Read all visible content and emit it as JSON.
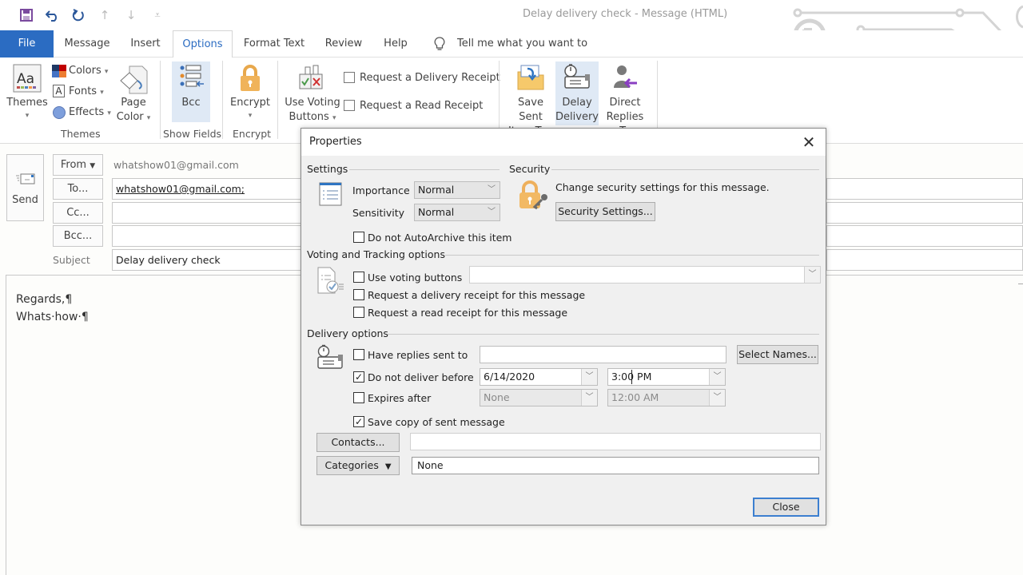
{
  "window": {
    "title": "Delay delivery check  -  Message (HTML)"
  },
  "quick_access": [
    {
      "name": "save-icon",
      "glyph": "💾"
    },
    {
      "name": "undo-icon",
      "glyph": "↶"
    },
    {
      "name": "redo-icon",
      "glyph": "↻"
    },
    {
      "name": "up-arrow-icon",
      "glyph": "↑"
    },
    {
      "name": "down-arrow-icon",
      "glyph": "↓"
    },
    {
      "name": "customize-qat-icon",
      "glyph": "▿"
    }
  ],
  "tabs": {
    "file": "File",
    "message": "Message",
    "insert": "Insert",
    "options": "Options",
    "format_text": "Format Text",
    "review": "Review",
    "help": "Help",
    "tell_me": "Tell me what you want to do"
  },
  "ribbon": {
    "themes": "Themes",
    "colors": "Colors",
    "fonts": "Fonts",
    "effects": "Effects",
    "page_color_1": "Page",
    "page_color_2": "Color",
    "themes_group": "Themes",
    "bcc": "Bcc",
    "show_fields_group": "Show Fields",
    "encrypt": "Encrypt",
    "encrypt_group": "Encrypt",
    "use_voting_1": "Use Voting",
    "use_voting_2": "Buttons",
    "request_delivery_receipt": "Request a Delivery Receipt",
    "request_read_receipt": "Request a Read Receipt",
    "save_sent_1": "Save Sent",
    "save_sent_2": "Item To",
    "delay_1": "Delay",
    "delay_2": "Delivery",
    "direct_1": "Direct",
    "direct_2": "Replies To"
  },
  "compose": {
    "send": "Send",
    "from_button": "From",
    "from_value": "whatshow01@gmail.com",
    "to_button": "To...",
    "to_value": "whatshow01@gmail.com;",
    "cc_button": "Cc...",
    "cc_value": "",
    "bcc_button": "Bcc...",
    "bcc_value": "",
    "subject_label": "Subject",
    "subject_value": "Delay delivery check",
    "body_line1": "Regards,¶",
    "body_line2": "Whats·how·¶"
  },
  "dialog": {
    "title": "Properties",
    "settings": {
      "heading": "Settings",
      "importance_label": "Importance",
      "importance_value": "Normal",
      "sensitivity_label": "Sensitivity",
      "sensitivity_value": "Normal",
      "autoarchive_label": "Do not AutoArchive this item",
      "autoarchive_checked": false
    },
    "security": {
      "heading": "Security",
      "description": "Change security settings for this message.",
      "button": "Security Settings..."
    },
    "voting": {
      "heading": "Voting and Tracking options",
      "use_voting_label": "Use voting buttons",
      "use_voting_checked": false,
      "voting_value": "",
      "delivery_receipt_label": "Request a delivery receipt for this message",
      "delivery_receipt_checked": false,
      "read_receipt_label": "Request a read receipt for this message",
      "read_receipt_checked": false
    },
    "delivery": {
      "heading": "Delivery options",
      "replies_label": "Have replies sent to",
      "replies_checked": false,
      "replies_value": "",
      "select_names": "Select Names...",
      "deliver_before_label": "Do not deliver before",
      "deliver_before_checked": true,
      "deliver_date": "6/14/2020",
      "deliver_time": "3:00 PM",
      "expires_label": "Expires after",
      "expires_checked": false,
      "expires_date": "None",
      "expires_time": "12:00 AM",
      "save_copy_label": "Save copy of sent message",
      "save_copy_checked": true
    },
    "contacts_button": "Contacts...",
    "contacts_value": "",
    "categories_button": "Categories",
    "categories_value": "None",
    "close_button": "Close"
  }
}
